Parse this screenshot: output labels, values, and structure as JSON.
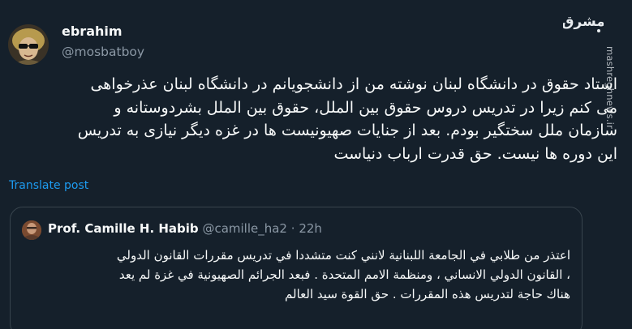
{
  "watermark": {
    "logo_text": "مشرق",
    "side_text": "mashreghnews.ir"
  },
  "post": {
    "author": {
      "display_name": "ebrahim",
      "handle": "@mosbatboy"
    },
    "body_lines": [
      "استاد حقوق در دانشگاه لبنان نوشته من از دانشجویانم در دانشگاه لبنان عذرخواهی",
      "می کنم زیرا در تدریس دروس حقوق بین الملل، حقوق بین الملل بشردوستانه و",
      "سازمان ملل سختگیر بودم.  بعد از جنایات صهیونیست ها در غزه دیگر نیازی به تدریس",
      "این دوره ها نیست.  حق قدرت ارباب دنیاست"
    ],
    "translate_label": "Translate post"
  },
  "quoted_post": {
    "author": {
      "display_name": "Prof. Camille H. Habib",
      "handle": "@camille_ha2",
      "separator": "·",
      "time": "22h"
    },
    "body_lines": [
      "اعتذر من طلابي في الجامعة اللبنانية لانني كنت متشددا في تدريس مقررات القانون الدولي",
      "، القانون الدولي الانساني ، ومنظمة الامم المتحدة . فبعد الجرائم الصهيونية في غزة لم يعد",
      "هناك حاجة لتدريس هذه المقررات . حق القوة سيد العالم"
    ]
  }
}
